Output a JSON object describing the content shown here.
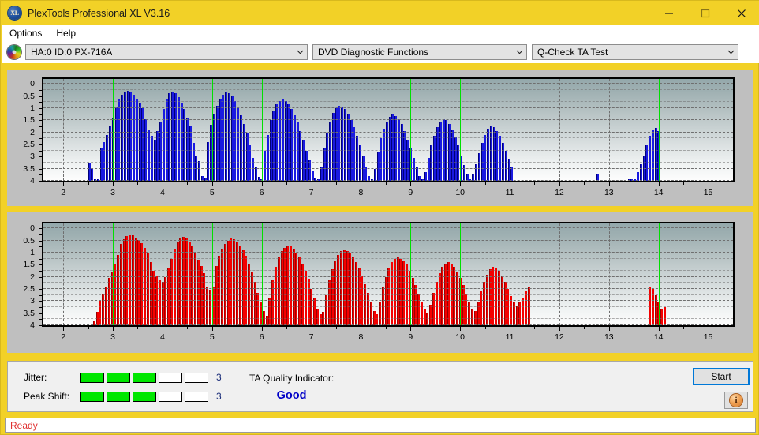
{
  "window": {
    "title": "PlexTools Professional XL V3.16",
    "app_icon": "xl-logo-icon",
    "minimize": "minimize-icon",
    "maximize": "maximize-icon",
    "close": "close-icon",
    "titlebar_color": "#f2d127"
  },
  "menu": {
    "items": [
      {
        "label": "Options"
      },
      {
        "label": "Help"
      }
    ]
  },
  "toolbar": {
    "drive_icon": "optical-disc-icon",
    "drive": "HA:0 ID:0  PX-716A",
    "function": "DVD Diagnostic Functions",
    "test": "Q-Check TA Test"
  },
  "charts": {
    "y_ticks": [
      "4",
      "3.5",
      "3",
      "2.5",
      "2",
      "1.5",
      "1",
      "0.5",
      "0"
    ],
    "x_ticks": [
      "2",
      "3",
      "4",
      "5",
      "6",
      "7",
      "8",
      "9",
      "10",
      "11",
      "12",
      "13",
      "14",
      "15"
    ],
    "colors": {
      "jitter_bar": "#1a1ae0",
      "peak_shift_bar": "#f40000",
      "marker": "#00e000"
    }
  },
  "chart_data": [
    {
      "type": "bar",
      "name": "Jitter",
      "title": "",
      "xlabel": "",
      "ylabel": "",
      "color": "#1a1ae0",
      "xlim": [
        1.6,
        15.5
      ],
      "ylim": [
        0,
        4.2
      ],
      "y_ticks": [
        0,
        0.5,
        1,
        1.5,
        2,
        2.5,
        3,
        3.5,
        4
      ],
      "x_ticks": [
        2,
        3,
        4,
        5,
        6,
        7,
        8,
        9,
        10,
        11,
        12,
        13,
        14,
        15
      ],
      "grid": true,
      "markers": [
        3,
        4,
        5,
        6,
        7,
        8,
        9,
        10,
        11,
        14
      ],
      "x": [
        2.5,
        2.56,
        2.62,
        2.68,
        2.74,
        2.8,
        2.86,
        2.92,
        2.98,
        3.04,
        3.1,
        3.16,
        3.22,
        3.28,
        3.34,
        3.4,
        3.46,
        3.52,
        3.58,
        3.64,
        3.7,
        3.76,
        3.82,
        3.88,
        3.94,
        4.0,
        4.06,
        4.12,
        4.18,
        4.24,
        4.3,
        4.36,
        4.42,
        4.48,
        4.54,
        4.6,
        4.66,
        4.72,
        4.78,
        4.84,
        4.9,
        4.96,
        5.02,
        5.08,
        5.14,
        5.2,
        5.26,
        5.32,
        5.38,
        5.44,
        5.5,
        5.56,
        5.62,
        5.68,
        5.74,
        5.8,
        5.86,
        5.92,
        5.98,
        6.04,
        6.1,
        6.16,
        6.22,
        6.28,
        6.34,
        6.4,
        6.46,
        6.52,
        6.58,
        6.64,
        6.7,
        6.76,
        6.82,
        6.88,
        6.94,
        7.0,
        7.06,
        7.12,
        7.18,
        7.24,
        7.3,
        7.36,
        7.42,
        7.48,
        7.54,
        7.6,
        7.66,
        7.72,
        7.78,
        7.84,
        7.9,
        7.96,
        8.02,
        8.08,
        8.14,
        8.2,
        8.26,
        8.32,
        8.38,
        8.44,
        8.5,
        8.56,
        8.62,
        8.68,
        8.74,
        8.8,
        8.86,
        8.92,
        8.98,
        9.04,
        9.1,
        9.16,
        9.22,
        9.28,
        9.34,
        9.4,
        9.46,
        9.52,
        9.58,
        9.64,
        9.7,
        9.76,
        9.82,
        9.88,
        9.94,
        10.0,
        10.06,
        10.12,
        10.18,
        10.24,
        10.3,
        10.36,
        10.42,
        10.48,
        10.54,
        10.6,
        10.66,
        10.72,
        10.78,
        10.84,
        10.9,
        10.96,
        11.02,
        12.75,
        13.38,
        13.44,
        13.5,
        13.56,
        13.62,
        13.68,
        13.74,
        13.8,
        13.86,
        13.92,
        13.98
      ],
      "values": [
        0.72,
        0.5,
        0.05,
        0.05,
        1.35,
        1.6,
        1.9,
        2.25,
        2.6,
        3.05,
        3.35,
        3.55,
        3.68,
        3.7,
        3.65,
        3.55,
        3.4,
        3.2,
        3.0,
        2.55,
        2.1,
        1.85,
        1.68,
        2.05,
        2.45,
        2.95,
        3.35,
        3.6,
        3.68,
        3.62,
        3.45,
        3.2,
        2.95,
        2.6,
        2.25,
        1.55,
        1.05,
        0.8,
        0.2,
        0.1,
        1.6,
        2.3,
        2.75,
        3.1,
        3.35,
        3.55,
        3.65,
        3.62,
        3.5,
        3.3,
        3.05,
        2.7,
        2.35,
        1.95,
        1.45,
        0.95,
        0.55,
        0.15,
        0.08,
        1.25,
        1.9,
        2.5,
        2.9,
        3.15,
        3.3,
        3.35,
        3.28,
        3.15,
        2.95,
        2.7,
        2.4,
        2.05,
        1.7,
        1.25,
        0.85,
        0.4,
        0.12,
        0.05,
        0.6,
        1.35,
        2.0,
        2.45,
        2.8,
        3.0,
        3.1,
        3.05,
        2.95,
        2.75,
        2.5,
        2.2,
        1.85,
        1.45,
        1.0,
        0.55,
        0.18,
        0.05,
        0.5,
        1.2,
        1.75,
        2.15,
        2.45,
        2.65,
        2.72,
        2.68,
        2.55,
        2.35,
        2.05,
        1.7,
        1.35,
        0.95,
        0.55,
        0.2,
        0.05,
        0.35,
        0.95,
        1.45,
        1.85,
        2.2,
        2.45,
        2.55,
        2.5,
        2.35,
        2.1,
        1.8,
        1.45,
        1.05,
        0.65,
        0.28,
        0.08,
        0.25,
        0.7,
        1.15,
        1.55,
        1.9,
        2.15,
        2.25,
        2.2,
        2.05,
        1.85,
        1.55,
        1.25,
        0.9,
        0.55,
        0.25,
        0.06,
        0.05,
        0.08,
        0.35,
        0.7,
        1.05,
        1.45,
        1.85,
        2.1,
        2.18,
        2.05,
        1.8,
        1.45,
        0.95,
        0.45
      ]
    },
    {
      "type": "bar",
      "name": "Peak Shift",
      "title": "",
      "xlabel": "",
      "ylabel": "",
      "color": "#f40000",
      "xlim": [
        1.6,
        15.5
      ],
      "ylim": [
        0,
        4.2
      ],
      "y_ticks": [
        0,
        0.5,
        1,
        1.5,
        2,
        2.5,
        3,
        3.5,
        4
      ],
      "x_ticks": [
        2,
        3,
        4,
        5,
        6,
        7,
        8,
        9,
        10,
        11,
        12,
        13,
        14,
        15
      ],
      "grid": true,
      "markers": [
        3,
        4,
        5,
        6,
        7,
        8,
        9,
        10,
        11,
        14
      ],
      "x": [
        2.6,
        2.66,
        2.72,
        2.78,
        2.84,
        2.9,
        2.96,
        3.02,
        3.08,
        3.14,
        3.2,
        3.26,
        3.32,
        3.38,
        3.44,
        3.5,
        3.56,
        3.62,
        3.68,
        3.74,
        3.8,
        3.86,
        3.92,
        3.98,
        4.04,
        4.1,
        4.16,
        4.22,
        4.28,
        4.34,
        4.4,
        4.46,
        4.52,
        4.58,
        4.64,
        4.7,
        4.76,
        4.82,
        4.88,
        4.94,
        5.0,
        5.06,
        5.12,
        5.18,
        5.24,
        5.3,
        5.36,
        5.42,
        5.48,
        5.54,
        5.6,
        5.66,
        5.72,
        5.78,
        5.84,
        5.9,
        5.96,
        6.02,
        6.08,
        6.14,
        6.2,
        6.26,
        6.32,
        6.38,
        6.44,
        6.5,
        6.56,
        6.62,
        6.68,
        6.74,
        6.8,
        6.86,
        6.92,
        6.98,
        7.04,
        7.1,
        7.16,
        7.22,
        7.28,
        7.34,
        7.4,
        7.46,
        7.52,
        7.58,
        7.64,
        7.7,
        7.76,
        7.82,
        7.88,
        7.94,
        8.0,
        8.06,
        8.12,
        8.18,
        8.24,
        8.3,
        8.36,
        8.42,
        8.48,
        8.54,
        8.6,
        8.66,
        8.72,
        8.78,
        8.84,
        8.9,
        8.96,
        9.02,
        9.08,
        9.14,
        9.2,
        9.26,
        9.32,
        9.38,
        9.44,
        9.5,
        9.56,
        9.62,
        9.68,
        9.74,
        9.8,
        9.86,
        9.92,
        9.98,
        10.04,
        10.1,
        10.16,
        10.22,
        10.28,
        10.34,
        10.4,
        10.46,
        10.52,
        10.58,
        10.64,
        10.7,
        10.76,
        10.82,
        10.88,
        10.94,
        11.0,
        11.06,
        11.12,
        11.18,
        11.24,
        11.3,
        11.36,
        13.8,
        13.86,
        13.92,
        13.98,
        14.04,
        14.1
      ],
      "values": [
        0.15,
        0.55,
        1.0,
        1.3,
        1.55,
        1.95,
        2.2,
        2.5,
        2.9,
        3.35,
        3.55,
        3.68,
        3.72,
        3.7,
        3.62,
        3.52,
        3.38,
        3.2,
        2.95,
        2.6,
        2.25,
        2.05,
        1.85,
        1.78,
        2.0,
        2.35,
        2.75,
        3.15,
        3.45,
        3.62,
        3.65,
        3.58,
        3.45,
        3.25,
        3.0,
        2.7,
        2.45,
        2.15,
        1.55,
        1.45,
        1.6,
        2.45,
        2.85,
        3.15,
        3.35,
        3.5,
        3.58,
        3.55,
        3.45,
        3.3,
        3.1,
        2.85,
        2.55,
        2.2,
        1.8,
        1.35,
        0.95,
        0.6,
        0.4,
        1.1,
        1.85,
        2.4,
        2.8,
        3.05,
        3.2,
        3.28,
        3.25,
        3.15,
        3.0,
        2.8,
        2.55,
        2.25,
        1.9,
        1.5,
        1.1,
        0.7,
        0.45,
        0.55,
        1.25,
        1.85,
        2.3,
        2.65,
        2.9,
        3.05,
        3.1,
        3.05,
        2.95,
        2.8,
        2.6,
        2.35,
        2.05,
        1.7,
        1.35,
        0.95,
        0.6,
        0.45,
        0.95,
        1.55,
        2.0,
        2.35,
        2.6,
        2.75,
        2.8,
        2.75,
        2.65,
        2.5,
        2.25,
        1.95,
        1.65,
        1.3,
        0.95,
        0.65,
        0.5,
        0.85,
        1.35,
        1.8,
        2.15,
        2.4,
        2.55,
        2.6,
        2.55,
        2.4,
        2.2,
        1.95,
        1.65,
        1.3,
        0.95,
        0.7,
        0.6,
        0.95,
        1.4,
        1.8,
        2.1,
        2.3,
        2.4,
        2.35,
        2.25,
        2.05,
        1.8,
        1.5,
        1.2,
        0.95,
        0.8,
        0.95,
        1.15,
        1.4,
        1.55,
        1.6,
        1.5,
        1.25,
        0.95,
        0.7,
        0.75,
        1.05,
        1.3,
        1.05,
        0.65,
        0.35
      ]
    }
  ],
  "bottom": {
    "jitter": {
      "label": "Jitter:",
      "segments_on": 3,
      "segments_total": 5,
      "value": "3"
    },
    "peak_shift": {
      "label": "Peak Shift:",
      "segments_on": 3,
      "segments_total": 5,
      "value": "3"
    },
    "ta_quality": {
      "label": "TA Quality Indicator:",
      "value": "Good"
    },
    "start_button": "Start",
    "info_button": "info-icon"
  },
  "statusbar": {
    "text": "Ready"
  }
}
